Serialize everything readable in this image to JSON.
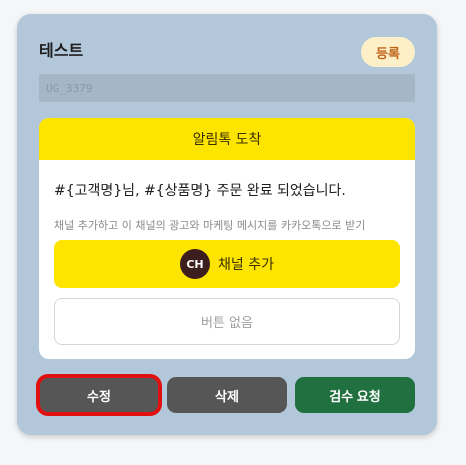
{
  "template": {
    "title": "테스트",
    "status": "등록",
    "code": "UG_3379"
  },
  "bubble": {
    "header": "알림톡 도착",
    "message": "#{고객명}님, #{상품명} 주문 완료 되었습니다.",
    "channel_notice": "채널 추가하고 이 채널의 광고와 마케팅 메시지를 카카오톡으로 받기",
    "channel_icon_text": "CH",
    "channel_button": "채널 추가",
    "no_button": "버튼 없음"
  },
  "actions": {
    "edit": "수정",
    "delete": "삭제",
    "review": "검수 요청"
  },
  "colors": {
    "card_bg": "#b3c7db",
    "kakao_yellow": "#fee500",
    "review_green": "#207040",
    "highlight_red": "#e01010"
  }
}
